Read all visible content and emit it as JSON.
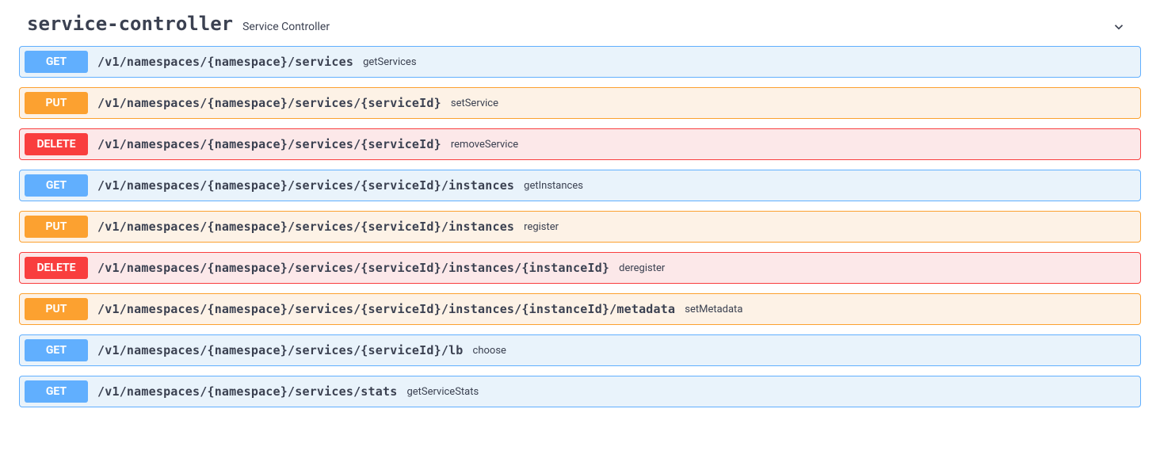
{
  "section": {
    "name": "service-controller",
    "description": "Service Controller"
  },
  "methods": {
    "get": "GET",
    "put": "PUT",
    "delete": "DELETE"
  },
  "operations": [
    {
      "method": "get",
      "path": "/v1/namespaces/{namespace}/services",
      "summary": "getServices"
    },
    {
      "method": "put",
      "path": "/v1/namespaces/{namespace}/services/{serviceId}",
      "summary": "setService"
    },
    {
      "method": "delete",
      "path": "/v1/namespaces/{namespace}/services/{serviceId}",
      "summary": "removeService"
    },
    {
      "method": "get",
      "path": "/v1/namespaces/{namespace}/services/{serviceId}/instances",
      "summary": "getInstances"
    },
    {
      "method": "put",
      "path": "/v1/namespaces/{namespace}/services/{serviceId}/instances",
      "summary": "register"
    },
    {
      "method": "delete",
      "path": "/v1/namespaces/{namespace}/services/{serviceId}/instances/{instanceId}",
      "summary": "deregister"
    },
    {
      "method": "put",
      "path": "/v1/namespaces/{namespace}/services/{serviceId}/instances/{instanceId}/metadata",
      "summary": "setMetadata"
    },
    {
      "method": "get",
      "path": "/v1/namespaces/{namespace}/services/{serviceId}/lb",
      "summary": "choose"
    },
    {
      "method": "get",
      "path": "/v1/namespaces/{namespace}/services/stats",
      "summary": "getServiceStats"
    }
  ]
}
